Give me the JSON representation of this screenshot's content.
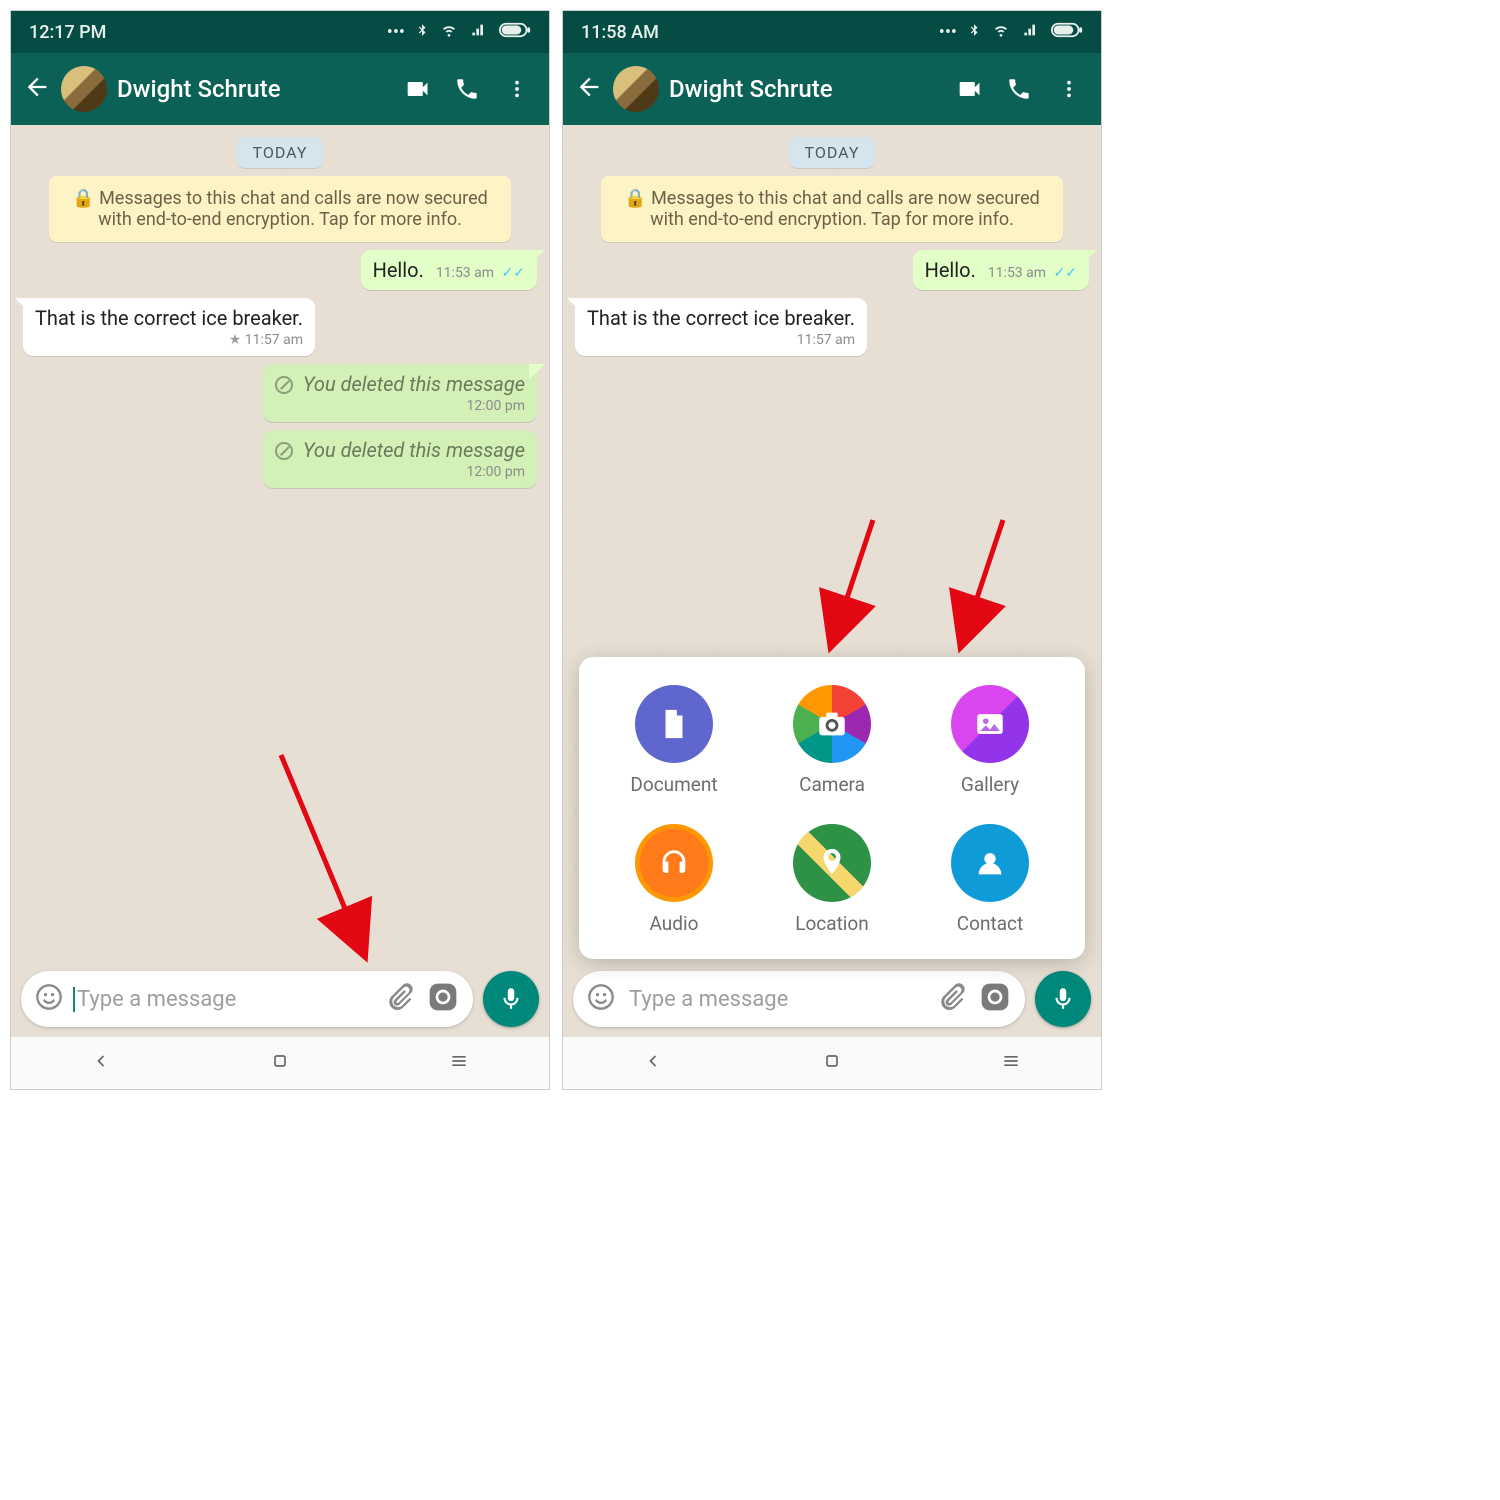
{
  "left": {
    "status_time": "12:17 PM",
    "contact_name": "Dwight Schrute",
    "date_label": "TODAY",
    "encryption_notice": "Messages to this chat and calls are now secured with end-to-end encryption. Tap for more info.",
    "messages": [
      {
        "dir": "out",
        "text": "Hello.",
        "time": "11:53 am",
        "read": true
      },
      {
        "dir": "in",
        "text": "That is the correct ice breaker.",
        "time": "11:57 am",
        "starred": true
      },
      {
        "dir": "out",
        "deleted": true,
        "text": "You deleted this message",
        "time": "12:00 pm"
      },
      {
        "dir": "out",
        "deleted": true,
        "text": "You deleted this message",
        "time": "12:00 pm"
      }
    ],
    "input_placeholder": "Type a message"
  },
  "right": {
    "status_time": "11:58 AM",
    "contact_name": "Dwight Schrute",
    "date_label": "TODAY",
    "encryption_notice": "Messages to this chat and calls are now secured with end-to-end encryption. Tap for more info.",
    "messages": [
      {
        "dir": "out",
        "text": "Hello.",
        "time": "11:53 am",
        "read": true
      },
      {
        "dir": "in",
        "text": "That is the correct ice breaker.",
        "time": "11:57 am"
      }
    ],
    "input_placeholder": "Type a message",
    "attach_options": [
      {
        "label": "Document"
      },
      {
        "label": "Camera"
      },
      {
        "label": "Gallery"
      },
      {
        "label": "Audio"
      },
      {
        "label": "Location"
      },
      {
        "label": "Contact"
      }
    ]
  }
}
